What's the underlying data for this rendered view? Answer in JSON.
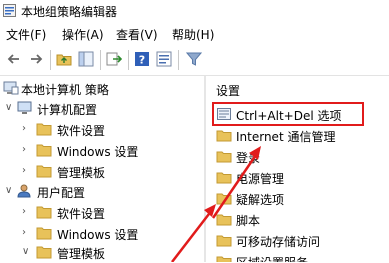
{
  "window": {
    "title": "本地组策略编辑器"
  },
  "menu": [
    {
      "label": "文件(F)"
    },
    {
      "label": "操作(A)"
    },
    {
      "label": "查看(V)"
    },
    {
      "label": "帮助(H)"
    }
  ],
  "toolbar": {
    "icons": [
      "back-icon",
      "forward-icon",
      "folder-up-icon",
      "show-hide-tree-icon",
      "export-list-icon",
      "help-icon",
      "properties-icon",
      "filter-icon"
    ]
  },
  "tree": {
    "root": "本地计算机 策略",
    "computer_config": "计算机配置",
    "cc_software": "软件设置",
    "cc_windows": "Windows 设置",
    "cc_admin": "管理模板",
    "user_config": "用户配置",
    "uc_software": "软件设置",
    "uc_windows": "Windows 设置",
    "uc_admin": "管理模板"
  },
  "right": {
    "header": "设置",
    "items": [
      {
        "label": "Ctrl+Alt+Del 选项"
      },
      {
        "label": "Internet 通信管理"
      },
      {
        "label": "登录"
      },
      {
        "label": "电源管理"
      },
      {
        "label": "疑解选项"
      },
      {
        "label": "脚本"
      },
      {
        "label": "可移动存储访问"
      },
      {
        "label": "区域设置服务"
      }
    ]
  },
  "colors": {
    "annotation": "#e11b1b",
    "folder": "#e8c25a",
    "selection_border": "#e11b1b"
  }
}
